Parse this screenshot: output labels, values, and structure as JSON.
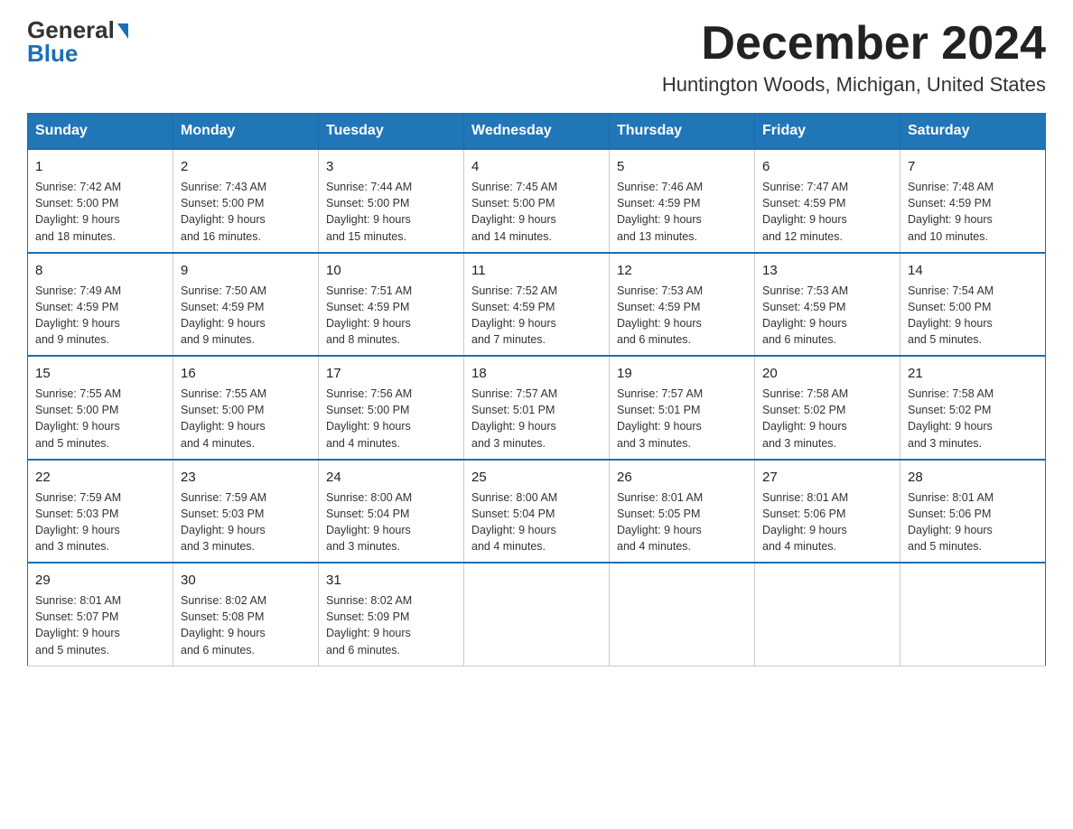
{
  "logo": {
    "general": "General",
    "blue": "Blue"
  },
  "title": {
    "month": "December 2024",
    "location": "Huntington Woods, Michigan, United States"
  },
  "headers": [
    "Sunday",
    "Monday",
    "Tuesday",
    "Wednesday",
    "Thursday",
    "Friday",
    "Saturday"
  ],
  "weeks": [
    [
      {
        "day": "1",
        "info": "Sunrise: 7:42 AM\nSunset: 5:00 PM\nDaylight: 9 hours\nand 18 minutes."
      },
      {
        "day": "2",
        "info": "Sunrise: 7:43 AM\nSunset: 5:00 PM\nDaylight: 9 hours\nand 16 minutes."
      },
      {
        "day": "3",
        "info": "Sunrise: 7:44 AM\nSunset: 5:00 PM\nDaylight: 9 hours\nand 15 minutes."
      },
      {
        "day": "4",
        "info": "Sunrise: 7:45 AM\nSunset: 5:00 PM\nDaylight: 9 hours\nand 14 minutes."
      },
      {
        "day": "5",
        "info": "Sunrise: 7:46 AM\nSunset: 4:59 PM\nDaylight: 9 hours\nand 13 minutes."
      },
      {
        "day": "6",
        "info": "Sunrise: 7:47 AM\nSunset: 4:59 PM\nDaylight: 9 hours\nand 12 minutes."
      },
      {
        "day": "7",
        "info": "Sunrise: 7:48 AM\nSunset: 4:59 PM\nDaylight: 9 hours\nand 10 minutes."
      }
    ],
    [
      {
        "day": "8",
        "info": "Sunrise: 7:49 AM\nSunset: 4:59 PM\nDaylight: 9 hours\nand 9 minutes."
      },
      {
        "day": "9",
        "info": "Sunrise: 7:50 AM\nSunset: 4:59 PM\nDaylight: 9 hours\nand 9 minutes."
      },
      {
        "day": "10",
        "info": "Sunrise: 7:51 AM\nSunset: 4:59 PM\nDaylight: 9 hours\nand 8 minutes."
      },
      {
        "day": "11",
        "info": "Sunrise: 7:52 AM\nSunset: 4:59 PM\nDaylight: 9 hours\nand 7 minutes."
      },
      {
        "day": "12",
        "info": "Sunrise: 7:53 AM\nSunset: 4:59 PM\nDaylight: 9 hours\nand 6 minutes."
      },
      {
        "day": "13",
        "info": "Sunrise: 7:53 AM\nSunset: 4:59 PM\nDaylight: 9 hours\nand 6 minutes."
      },
      {
        "day": "14",
        "info": "Sunrise: 7:54 AM\nSunset: 5:00 PM\nDaylight: 9 hours\nand 5 minutes."
      }
    ],
    [
      {
        "day": "15",
        "info": "Sunrise: 7:55 AM\nSunset: 5:00 PM\nDaylight: 9 hours\nand 5 minutes."
      },
      {
        "day": "16",
        "info": "Sunrise: 7:55 AM\nSunset: 5:00 PM\nDaylight: 9 hours\nand 4 minutes."
      },
      {
        "day": "17",
        "info": "Sunrise: 7:56 AM\nSunset: 5:00 PM\nDaylight: 9 hours\nand 4 minutes."
      },
      {
        "day": "18",
        "info": "Sunrise: 7:57 AM\nSunset: 5:01 PM\nDaylight: 9 hours\nand 3 minutes."
      },
      {
        "day": "19",
        "info": "Sunrise: 7:57 AM\nSunset: 5:01 PM\nDaylight: 9 hours\nand 3 minutes."
      },
      {
        "day": "20",
        "info": "Sunrise: 7:58 AM\nSunset: 5:02 PM\nDaylight: 9 hours\nand 3 minutes."
      },
      {
        "day": "21",
        "info": "Sunrise: 7:58 AM\nSunset: 5:02 PM\nDaylight: 9 hours\nand 3 minutes."
      }
    ],
    [
      {
        "day": "22",
        "info": "Sunrise: 7:59 AM\nSunset: 5:03 PM\nDaylight: 9 hours\nand 3 minutes."
      },
      {
        "day": "23",
        "info": "Sunrise: 7:59 AM\nSunset: 5:03 PM\nDaylight: 9 hours\nand 3 minutes."
      },
      {
        "day": "24",
        "info": "Sunrise: 8:00 AM\nSunset: 5:04 PM\nDaylight: 9 hours\nand 3 minutes."
      },
      {
        "day": "25",
        "info": "Sunrise: 8:00 AM\nSunset: 5:04 PM\nDaylight: 9 hours\nand 4 minutes."
      },
      {
        "day": "26",
        "info": "Sunrise: 8:01 AM\nSunset: 5:05 PM\nDaylight: 9 hours\nand 4 minutes."
      },
      {
        "day": "27",
        "info": "Sunrise: 8:01 AM\nSunset: 5:06 PM\nDaylight: 9 hours\nand 4 minutes."
      },
      {
        "day": "28",
        "info": "Sunrise: 8:01 AM\nSunset: 5:06 PM\nDaylight: 9 hours\nand 5 minutes."
      }
    ],
    [
      {
        "day": "29",
        "info": "Sunrise: 8:01 AM\nSunset: 5:07 PM\nDaylight: 9 hours\nand 5 minutes."
      },
      {
        "day": "30",
        "info": "Sunrise: 8:02 AM\nSunset: 5:08 PM\nDaylight: 9 hours\nand 6 minutes."
      },
      {
        "day": "31",
        "info": "Sunrise: 8:02 AM\nSunset: 5:09 PM\nDaylight: 9 hours\nand 6 minutes."
      },
      null,
      null,
      null,
      null
    ]
  ]
}
